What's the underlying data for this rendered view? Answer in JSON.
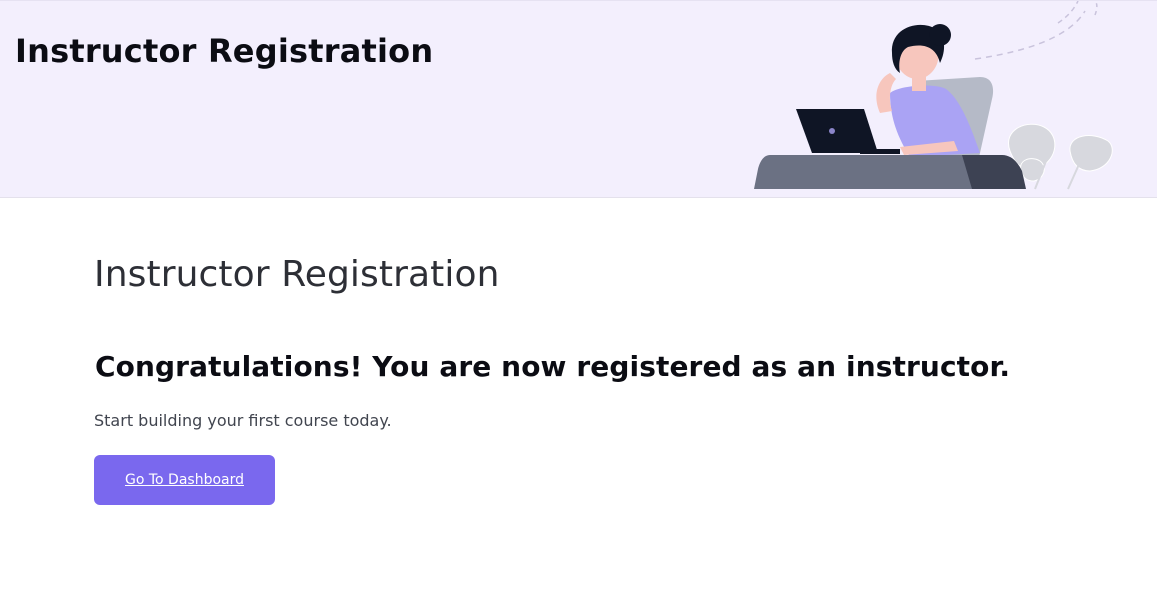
{
  "banner": {
    "title": "Instructor Registration",
    "illustration_icon": "woman-at-laptop-illustration",
    "background_color": "#f3effd"
  },
  "main": {
    "heading": "Instructor Registration",
    "congrats_message": "Congratulations! You are now registered as an instructor.",
    "subtext": "Start building your first course today.",
    "dashboard_button_label": "Go To Dashboard",
    "accent_color": "#7a68ee"
  }
}
